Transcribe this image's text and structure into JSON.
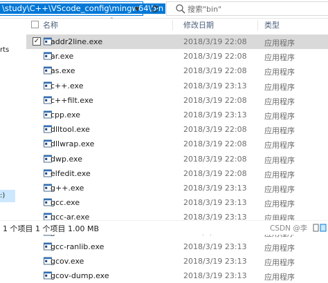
{
  "address_bar": {
    "path": "\\study\\C++\\VScode_config\\mingw64\\bin"
  },
  "search": {
    "placeholder": "搜索\"bin\""
  },
  "nav_pane": {
    "fragment_top": "rts",
    "fragment_bottom": ":)"
  },
  "columns": {
    "name": "名称",
    "date": "修改日期",
    "type": "类型"
  },
  "files": [
    {
      "name": "addr2line.exe",
      "date": "2018/3/19 22:08",
      "type": "应用程序",
      "selected": true
    },
    {
      "name": "ar.exe",
      "date": "2018/3/19 22:08",
      "type": "应用程序"
    },
    {
      "name": "as.exe",
      "date": "2018/3/19 22:08",
      "type": "应用程序"
    },
    {
      "name": "c++.exe",
      "date": "2018/3/19 23:13",
      "type": "应用程序"
    },
    {
      "name": "c++filt.exe",
      "date": "2018/3/19 22:08",
      "type": "应用程序"
    },
    {
      "name": "cpp.exe",
      "date": "2018/3/19 23:13",
      "type": "应用程序"
    },
    {
      "name": "dlltool.exe",
      "date": "2018/3/19 22:08",
      "type": "应用程序"
    },
    {
      "name": "dllwrap.exe",
      "date": "2018/3/19 22:08",
      "type": "应用程序"
    },
    {
      "name": "dwp.exe",
      "date": "2018/3/19 22:08",
      "type": "应用程序"
    },
    {
      "name": "elfedit.exe",
      "date": "2018/3/19 22:08",
      "type": "应用程序"
    },
    {
      "name": "g++.exe",
      "date": "2018/3/19 23:13",
      "type": "应用程序"
    },
    {
      "name": "gcc.exe",
      "date": "2018/3/19 23:13",
      "type": "应用程序"
    },
    {
      "name": "gcc-ar.exe",
      "date": "2018/3/19 23:13",
      "type": "应用程序"
    },
    {
      "name": "gcc-nm.exe",
      "date": "2018/3/19 23:13",
      "type": "应用程序"
    },
    {
      "name": "gcc-ranlib.exe",
      "date": "2018/3/19 23:13",
      "type": "应用程序"
    },
    {
      "name": "gcov.exe",
      "date": "2018/3/19 23:13",
      "type": "应用程序"
    },
    {
      "name": "gcov-dump.exe",
      "date": "2018/3/19 23:13",
      "type": "应用程序"
    }
  ],
  "status_bar": {
    "text": "1 个项目  1 个项目  1.00 MB",
    "watermark": "CSDN @李"
  },
  "colors": {
    "selection": "#0078d7",
    "row_selected": "#d9d9d9",
    "header_text": "#4c607a",
    "muted_text": "#6d6d6d"
  },
  "icons": {
    "refresh": "refresh-icon",
    "search": "search-icon",
    "file": "exe-file-icon",
    "dropdown": "chevron-down-icon"
  }
}
